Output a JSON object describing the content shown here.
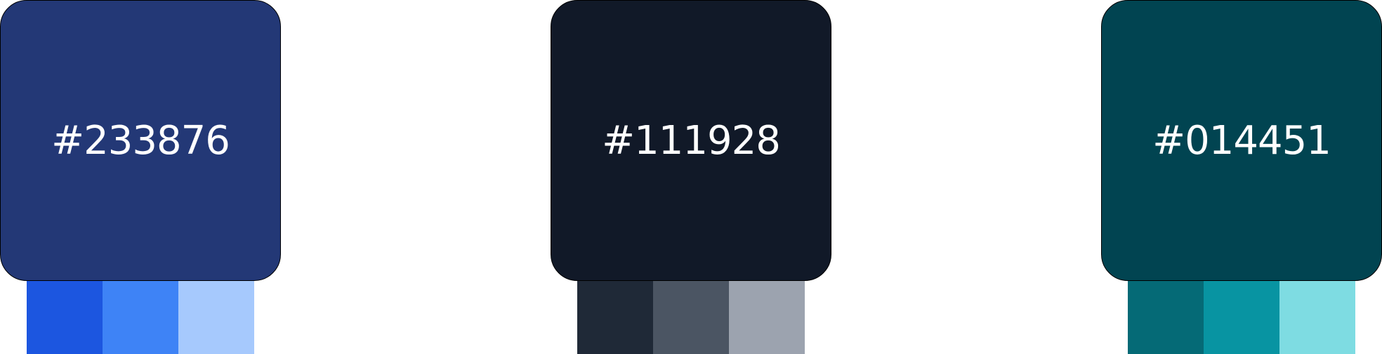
{
  "palettes": [
    {
      "base_hex": "#233876",
      "label": "#233876",
      "shades": [
        "#1C56E0",
        "#3E83F6",
        "#A6C9FD"
      ]
    },
    {
      "base_hex": "#111928",
      "label": "#111928",
      "shades": [
        "#1F2937",
        "#4B5563",
        "#9CA3AF"
      ]
    },
    {
      "base_hex": "#014451",
      "label": "#014451",
      "shades": [
        "#056A76",
        "#0894A2",
        "#7EDCE2"
      ]
    }
  ]
}
